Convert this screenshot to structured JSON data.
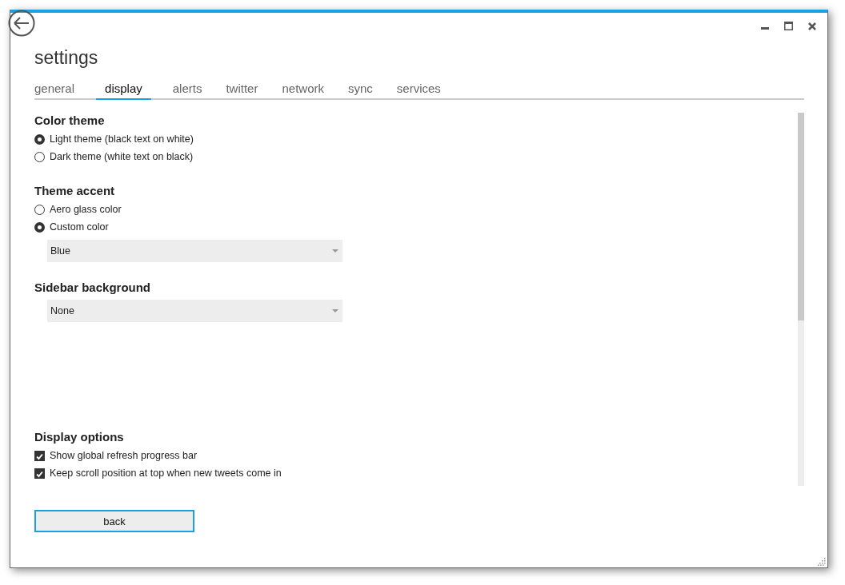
{
  "window": {
    "title": "settings"
  },
  "tabs": [
    {
      "label": "general",
      "selected": false
    },
    {
      "label": "display",
      "selected": true
    },
    {
      "label": "alerts",
      "selected": false
    },
    {
      "label": "twitter",
      "selected": false
    },
    {
      "label": "network",
      "selected": false
    },
    {
      "label": "sync",
      "selected": false
    },
    {
      "label": "services",
      "selected": false
    }
  ],
  "sections": [
    {
      "heading": "Color theme",
      "items": [
        {
          "kind": "radio",
          "label": "Light theme (black text on white)",
          "selected": true
        },
        {
          "kind": "radio",
          "label": "Dark theme (white text on black)",
          "selected": false
        }
      ]
    },
    {
      "heading": "Theme accent",
      "items": [
        {
          "kind": "radio",
          "label": "Aero glass color",
          "selected": false
        },
        {
          "kind": "radio",
          "label": "Custom color",
          "selected": true
        },
        {
          "kind": "dropdown",
          "value": "Blue"
        }
      ]
    },
    {
      "heading": "Sidebar background",
      "items": [
        {
          "kind": "dropdown",
          "value": "None"
        }
      ]
    },
    {
      "heading": "Display options",
      "items": [
        {
          "kind": "checkbox",
          "label": "Show global refresh progress bar",
          "checked": true
        },
        {
          "kind": "checkbox",
          "label": "Keep scroll position at top when new tweets come in",
          "checked": true
        }
      ]
    }
  ],
  "back_button": {
    "label": "back"
  }
}
